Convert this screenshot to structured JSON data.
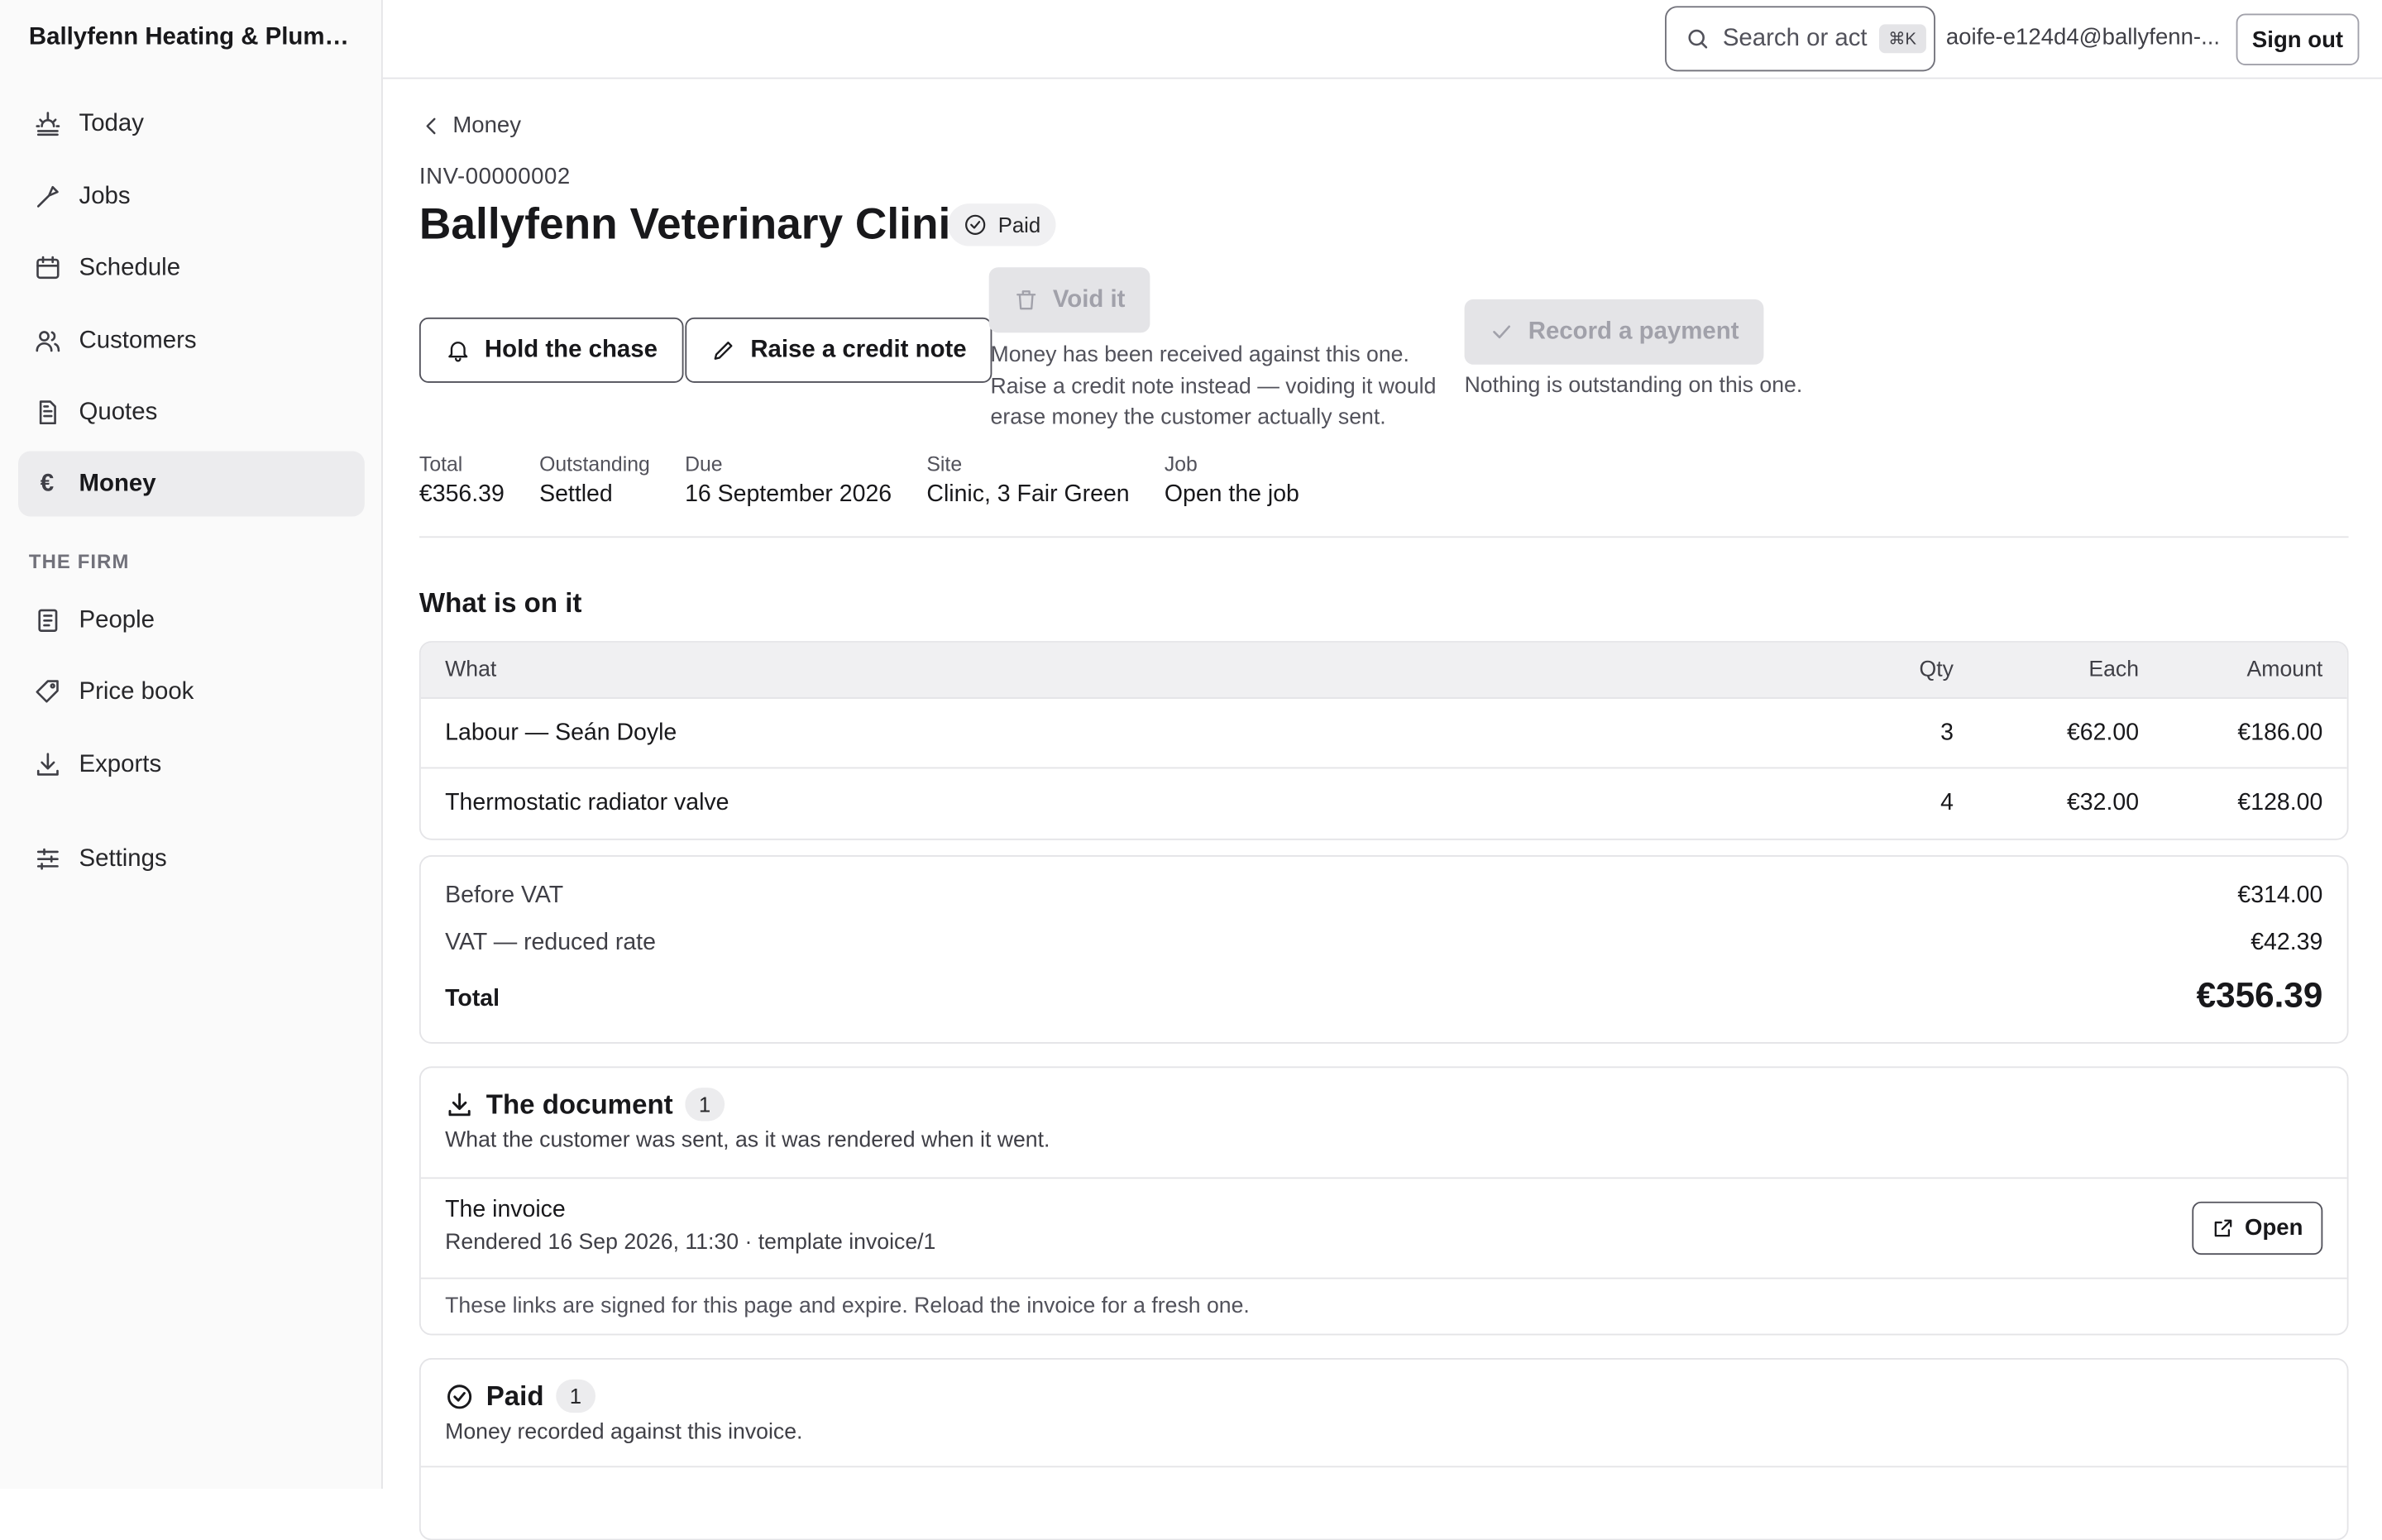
{
  "sidebar": {
    "brand": "Ballyfenn Heating & Plumbi...",
    "items": [
      {
        "label": "Today",
        "icon": "sunrise-icon"
      },
      {
        "label": "Jobs",
        "icon": "wrench-icon"
      },
      {
        "label": "Schedule",
        "icon": "calendar-icon"
      },
      {
        "label": "Customers",
        "icon": "users-icon"
      },
      {
        "label": "Quotes",
        "icon": "document-icon"
      },
      {
        "label": "Money",
        "icon": "euro-icon",
        "active": true
      }
    ],
    "section_label": "THE FIRM",
    "firm_items": [
      {
        "label": "People",
        "icon": "notebook-icon"
      },
      {
        "label": "Price book",
        "icon": "tag-icon"
      },
      {
        "label": "Exports",
        "icon": "download-icon"
      }
    ],
    "settings_label": "Settings"
  },
  "topbar": {
    "search_placeholder": "Search or act",
    "search_shortcut": "⌘K",
    "user_email": "aoife-e124d4@ballyfenn-...",
    "signout_label": "Sign out"
  },
  "page": {
    "back_label": "Money",
    "invoice_number": "INV-00000002",
    "title": "Ballyfenn Veterinary Clinic",
    "status_badge": "Paid"
  },
  "actions": {
    "hold_chase": "Hold the chase",
    "credit_note": "Raise a credit note",
    "void": "Void it",
    "void_help_1": "Money has been received against this one.",
    "void_help_2": "Raise a credit note instead — voiding it would",
    "void_help_3": "erase money the customer actually sent.",
    "record_payment": "Record a payment",
    "record_help": "Nothing is outstanding on this one."
  },
  "meta": {
    "total_label": "Total",
    "total_value": "€356.39",
    "outstanding_label": "Outstanding",
    "outstanding_value": "Settled",
    "due_label": "Due",
    "due_value": "16 September 2026",
    "site_label": "Site",
    "site_value": "Clinic, 3 Fair Green",
    "job_label": "Job",
    "job_value": "Open the job"
  },
  "lines": {
    "heading": "What is on it",
    "columns": {
      "what": "What",
      "qty": "Qty",
      "each": "Each",
      "amount": "Amount"
    },
    "rows": [
      {
        "what": "Labour — Seán Doyle",
        "qty": "3",
        "each": "€62.00",
        "amount": "€186.00"
      },
      {
        "what": "Thermostatic radiator valve",
        "qty": "4",
        "each": "€32.00",
        "amount": "€128.00"
      }
    ]
  },
  "totals": {
    "before_vat_label": "Before VAT",
    "before_vat_value": "€314.00",
    "vat_label": "VAT — reduced rate",
    "vat_value": "€42.39",
    "total_label": "Total",
    "total_value": "€356.39"
  },
  "document": {
    "title": "The document",
    "count": "1",
    "subtitle": "What the customer was sent, as it was rendered when it went.",
    "item_title": "The invoice",
    "item_meta": "Rendered 16 Sep 2026, 11:30 · template invoice/1",
    "open_label": "Open",
    "footnote": "These links are signed for this page and expire. Reload the invoice for a fresh one."
  },
  "paid": {
    "title": "Paid",
    "count": "1",
    "subtitle": "Money recorded against this invoice."
  }
}
